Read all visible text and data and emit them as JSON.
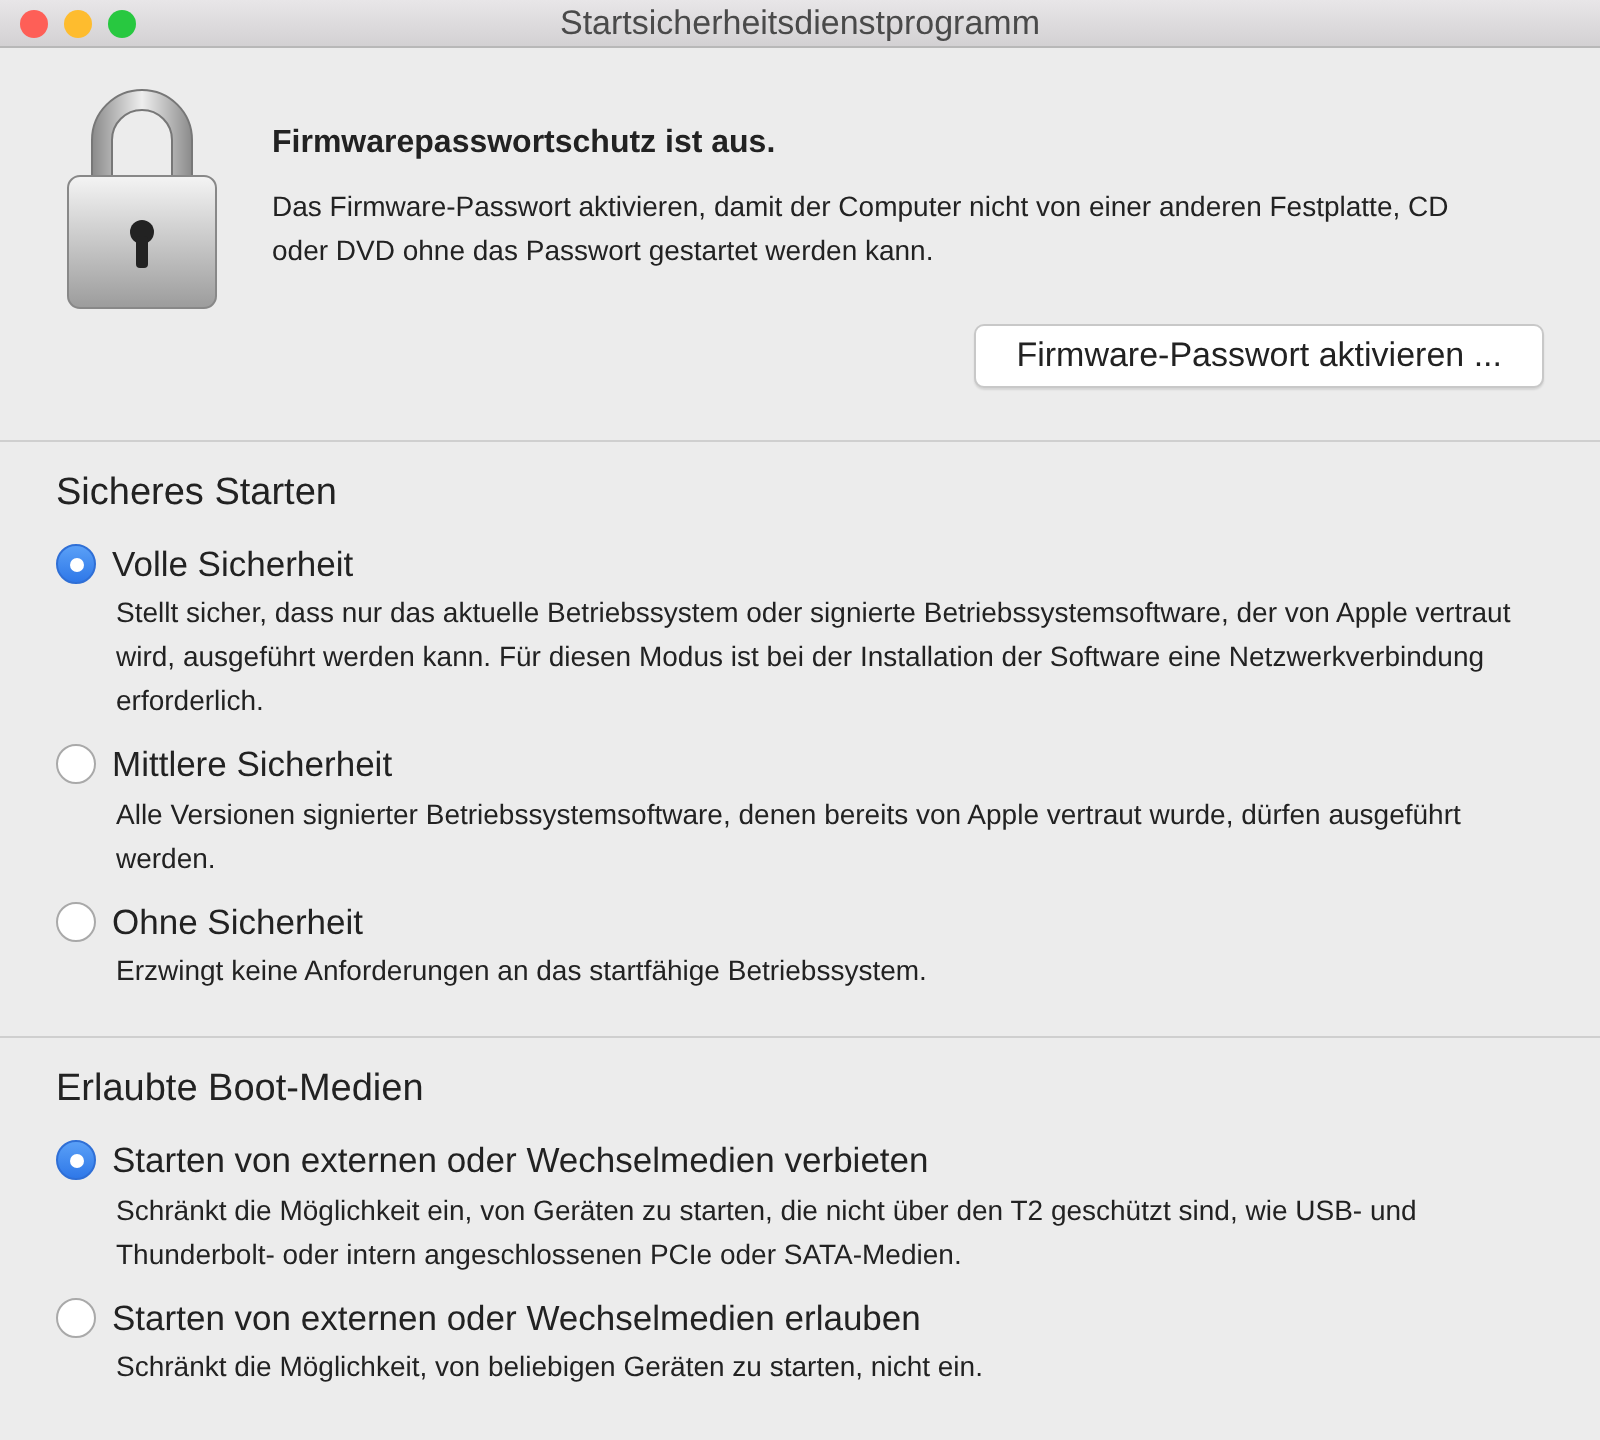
{
  "window": {
    "title": "Startsicherheitsdienstprogramm"
  },
  "firmware": {
    "heading": "Firmwarepasswortschutz ist aus.",
    "description": "Das Firmware-Passwort aktivieren, damit der Computer nicht von einer anderen Festplatte, CD oder DVD ohne das Passwort gestartet werden kann.",
    "button": "Firmware-Passwort aktivieren ..."
  },
  "sections": [
    {
      "title": "Sicheres Starten",
      "options": [
        {
          "label": "Volle Sicherheit",
          "selected": true,
          "description": "Stellt sicher, dass nur das aktuelle Betriebssystem oder signierte Betriebssystemsoftware, der von Apple vertraut wird, ausgeführt werden kann. Für diesen Modus ist bei der Installation der Software eine Netzwerkverbindung erforderlich."
        },
        {
          "label": "Mittlere Sicherheit",
          "selected": false,
          "description": "Alle Versionen signierter Betriebssystemsoftware, denen bereits von Apple vertraut wurde, dürfen ausgeführt werden."
        },
        {
          "label": "Ohne Sicherheit",
          "selected": false,
          "description": "Erzwingt keine Anforderungen an das startfähige Betriebssystem."
        }
      ]
    },
    {
      "title": "Erlaubte Boot-Medien",
      "options": [
        {
          "label": "Starten von externen oder Wechselmedien verbieten",
          "selected": true,
          "description": "Schränkt die Möglichkeit ein, von Geräten zu starten, die nicht über den T2 geschützt sind, wie USB- und Thunderbolt- oder intern angeschlossenen PCIe oder SATA-Medien."
        },
        {
          "label": "Starten von externen oder Wechselmedien erlauben",
          "selected": false,
          "description": "Schränkt die Möglichkeit, von beliebigen Geräten zu starten, nicht ein."
        }
      ]
    }
  ]
}
